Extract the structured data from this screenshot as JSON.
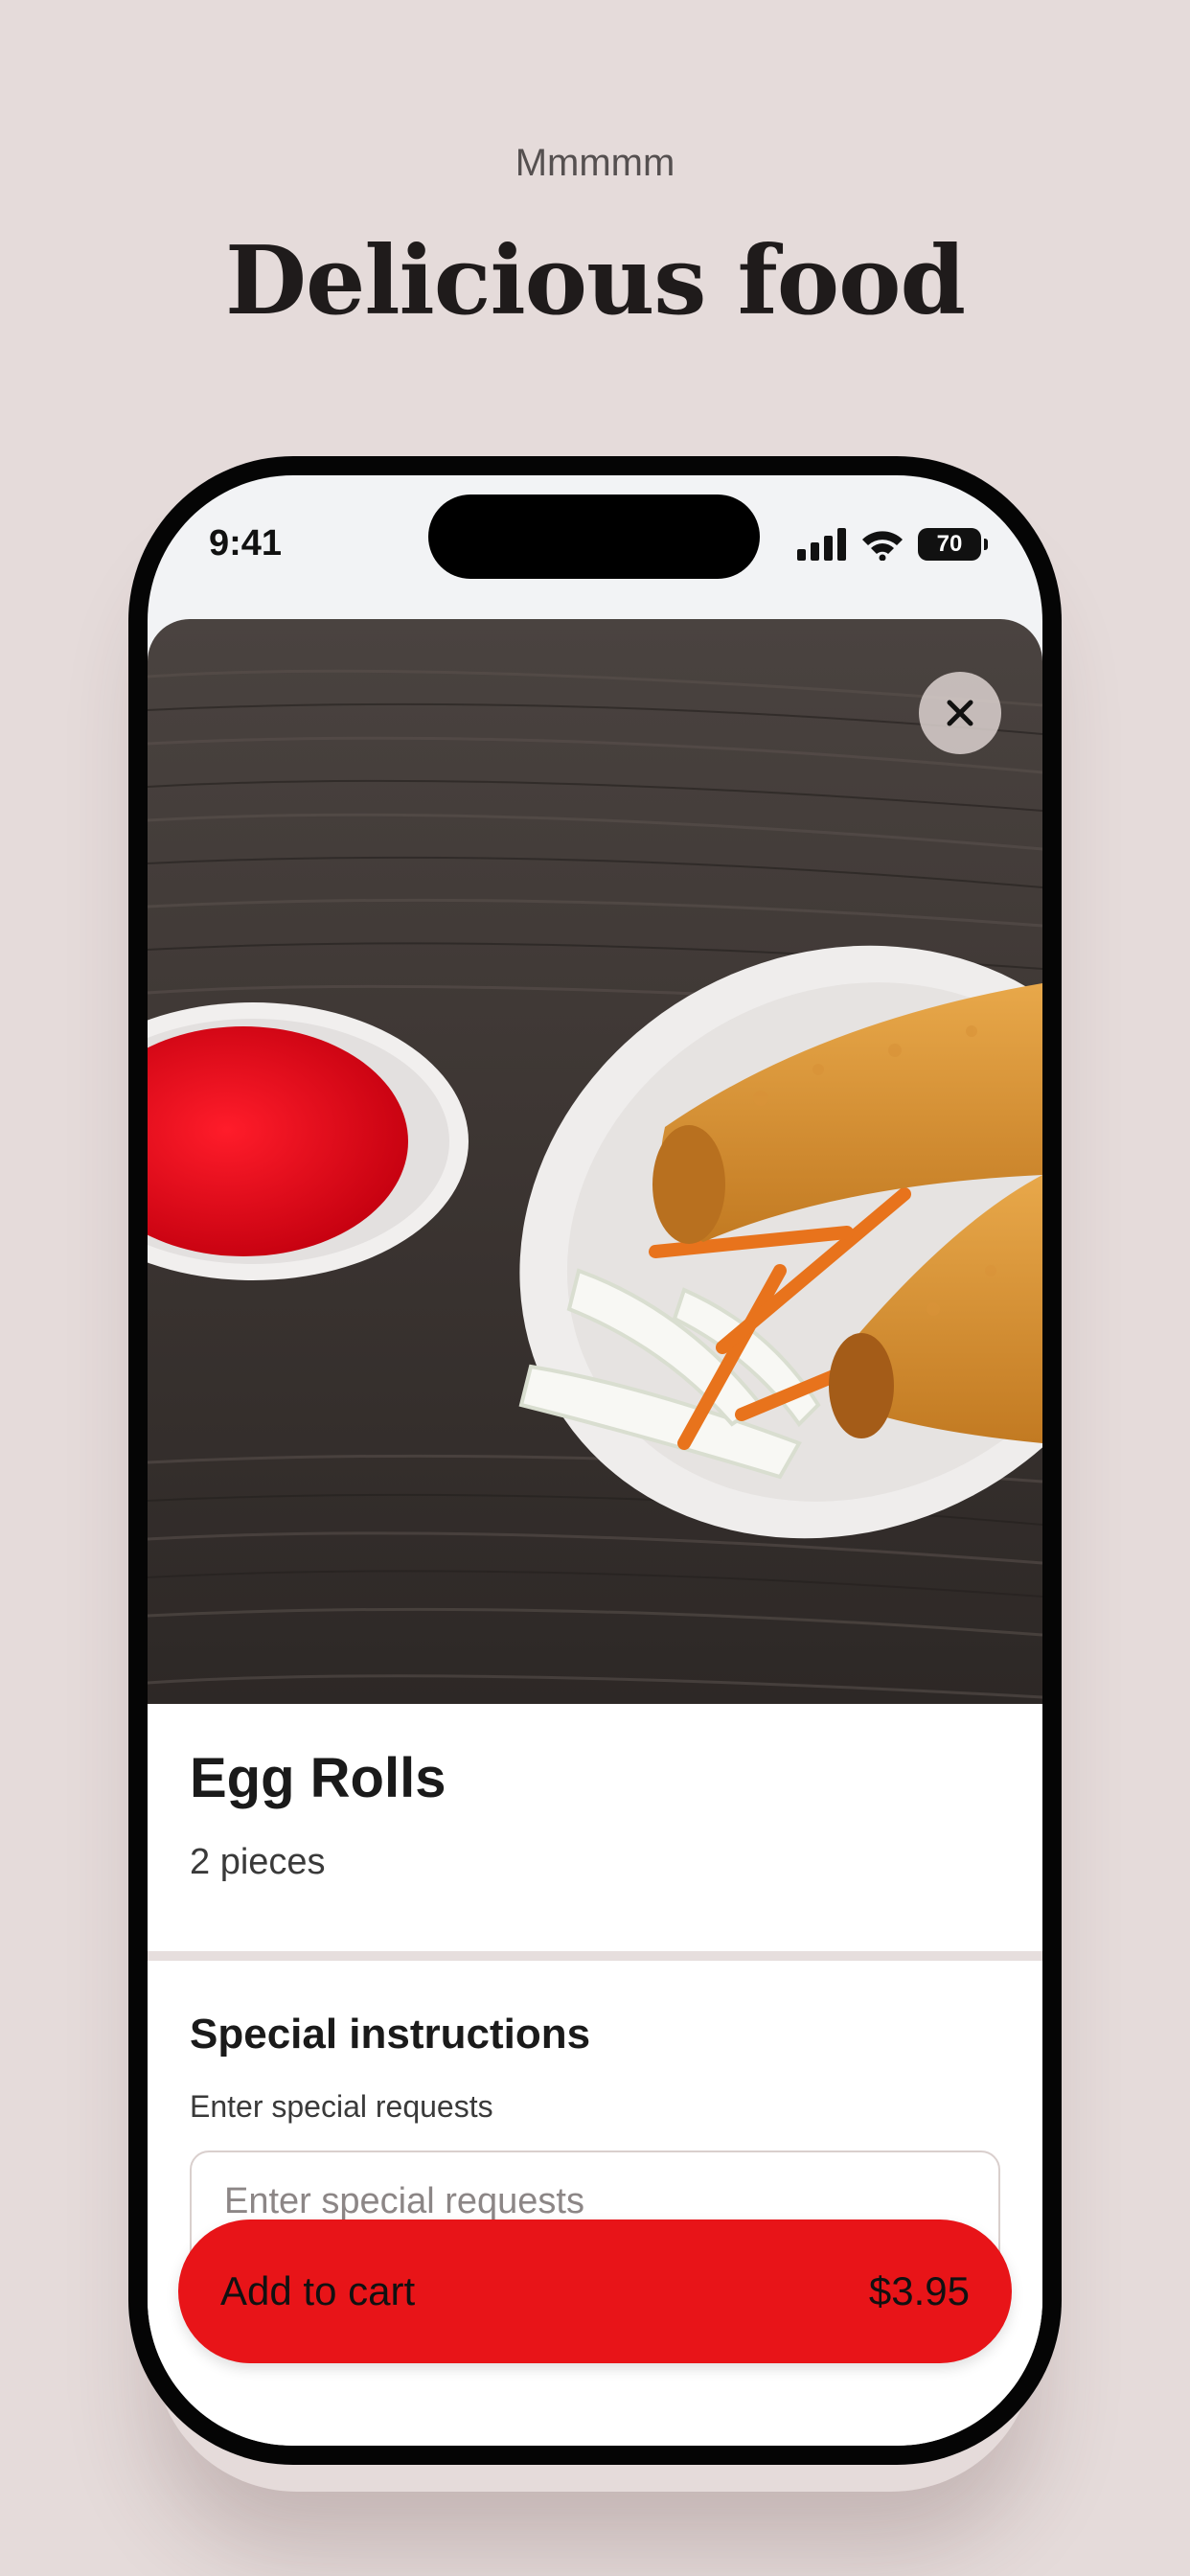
{
  "promo": {
    "subtitle": "Mmmmm",
    "title": "Delicious food"
  },
  "status_bar": {
    "time": "9:41",
    "battery": "70",
    "icons": [
      "cellular-signal-icon",
      "wifi-icon",
      "battery-icon"
    ]
  },
  "item": {
    "photo_icon": "egg-rolls-photo",
    "name": "Egg Rolls",
    "description": "2 pieces",
    "close_icon": "close-icon"
  },
  "special_instructions": {
    "title": "Special instructions",
    "subtitle": "Enter special requests",
    "placeholder": "Enter special requests"
  },
  "cart_button": {
    "label": "Add to cart",
    "price": "$3.95"
  },
  "colors": {
    "background": "#e5dbda",
    "accent": "#e81418",
    "text": "#1a1a1a"
  }
}
